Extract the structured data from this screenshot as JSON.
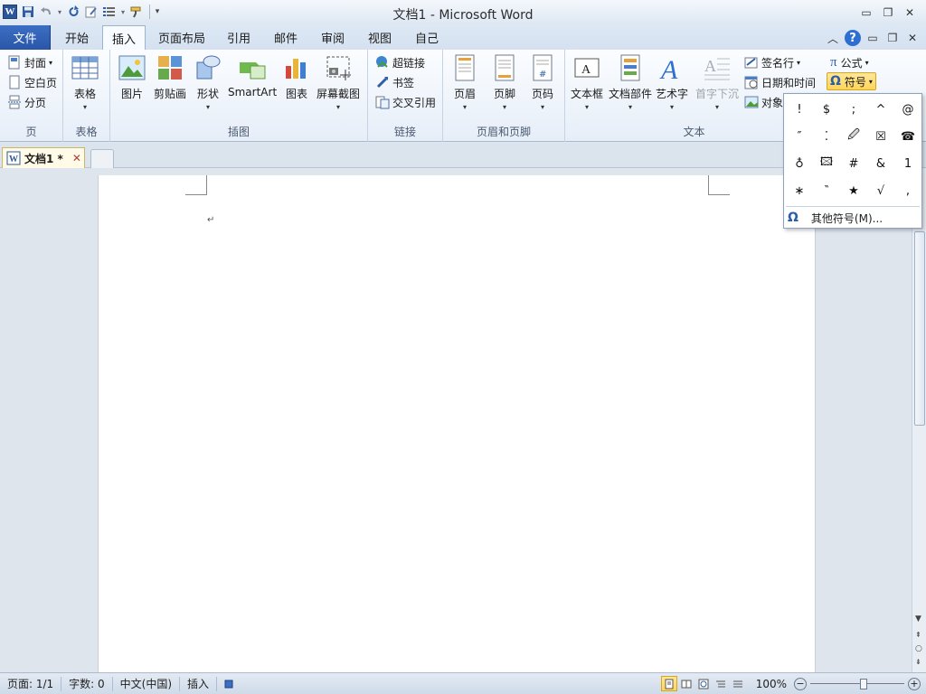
{
  "window": {
    "title": "文档1 - Microsoft Word"
  },
  "quick_access": {
    "logo": "W",
    "items": [
      "save-icon",
      "undo-icon",
      "redo-icon",
      "edit-icon",
      "bullets-icon",
      "format-painter-icon",
      "customize-icon"
    ]
  },
  "tabs": {
    "file": "文件",
    "items": [
      "开始",
      "插入",
      "页面布局",
      "引用",
      "邮件",
      "审阅",
      "视图",
      "自己"
    ],
    "active": "插入"
  },
  "ribbon": {
    "pages": {
      "label": "页",
      "cover": "封面",
      "blank": "空白页",
      "break": "分页"
    },
    "tables": {
      "label": "表格",
      "table": "表格"
    },
    "illustrations": {
      "label": "插图",
      "picture": "图片",
      "clipart": "剪贴画",
      "shapes": "形状",
      "smartart": "SmartArt",
      "chart": "图表",
      "screenshot": "屏幕截图"
    },
    "links": {
      "label": "链接",
      "hyperlink": "超链接",
      "bookmark": "书签",
      "crossref": "交叉引用"
    },
    "header_footer": {
      "label": "页眉和页脚",
      "header": "页眉",
      "footer": "页脚",
      "page_number": "页码"
    },
    "text": {
      "label": "文本",
      "textbox": "文本框",
      "quickparts": "文档部件",
      "wordart": "艺术字",
      "dropcap": "首字下沉",
      "signature": "签名行",
      "datetime": "日期和时间",
      "object": "对象"
    },
    "symbols": {
      "equation": "公式",
      "symbol": "符号"
    }
  },
  "document": {
    "tab_name": "文档1 *",
    "close": "✕",
    "para_mark": "↵"
  },
  "symbol_dropdown": {
    "symbols": [
      "!",
      "$",
      ";",
      "^",
      "@",
      "″",
      "⁚",
      "🖉",
      "☒",
      "☎",
      "♁",
      "🖾",
      "#",
      "&",
      "1",
      "∗",
      "‶",
      "★",
      "√",
      ","
    ],
    "more": "其他符号(M)..."
  },
  "status": {
    "page": "页面: 1/1",
    "words": "字数: 0",
    "language": "中文(中国)",
    "mode": "插入",
    "zoom": "100%"
  },
  "colors": {
    "accent": "#2b579a",
    "file_tab": "#2a56a8",
    "highlight": "#ffd55a"
  }
}
